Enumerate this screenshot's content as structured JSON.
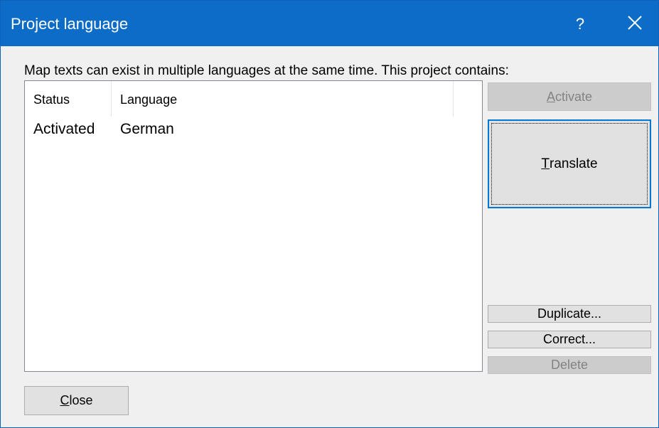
{
  "window": {
    "title": "Project language",
    "help_label": "?",
    "close_icon": "close-icon"
  },
  "description": "Map texts can exist in multiple languages at the same time. This project contains:",
  "table": {
    "columns": [
      "Status",
      "Language"
    ],
    "rows": [
      {
        "status": "Activated",
        "language": "German"
      }
    ]
  },
  "buttons": {
    "activate": {
      "label": "Activate",
      "mnemonic": "A",
      "rest": "ctivate",
      "enabled": false
    },
    "translate": {
      "label": "Translate",
      "mnemonic": "T",
      "rest": "ranslate",
      "enabled": true,
      "default": true
    },
    "duplicate": {
      "label": "Duplicate...",
      "enabled": true
    },
    "correct": {
      "label": "Correct...",
      "enabled": true
    },
    "delete": {
      "label": "Delete",
      "enabled": false
    },
    "close": {
      "label": "Close",
      "mnemonic": "C",
      "rest": "lose",
      "enabled": true
    }
  },
  "colors": {
    "titlebar": "#0c6cc7",
    "dialog_bg": "#f0f0f0",
    "focus_border": "#0078d7"
  }
}
